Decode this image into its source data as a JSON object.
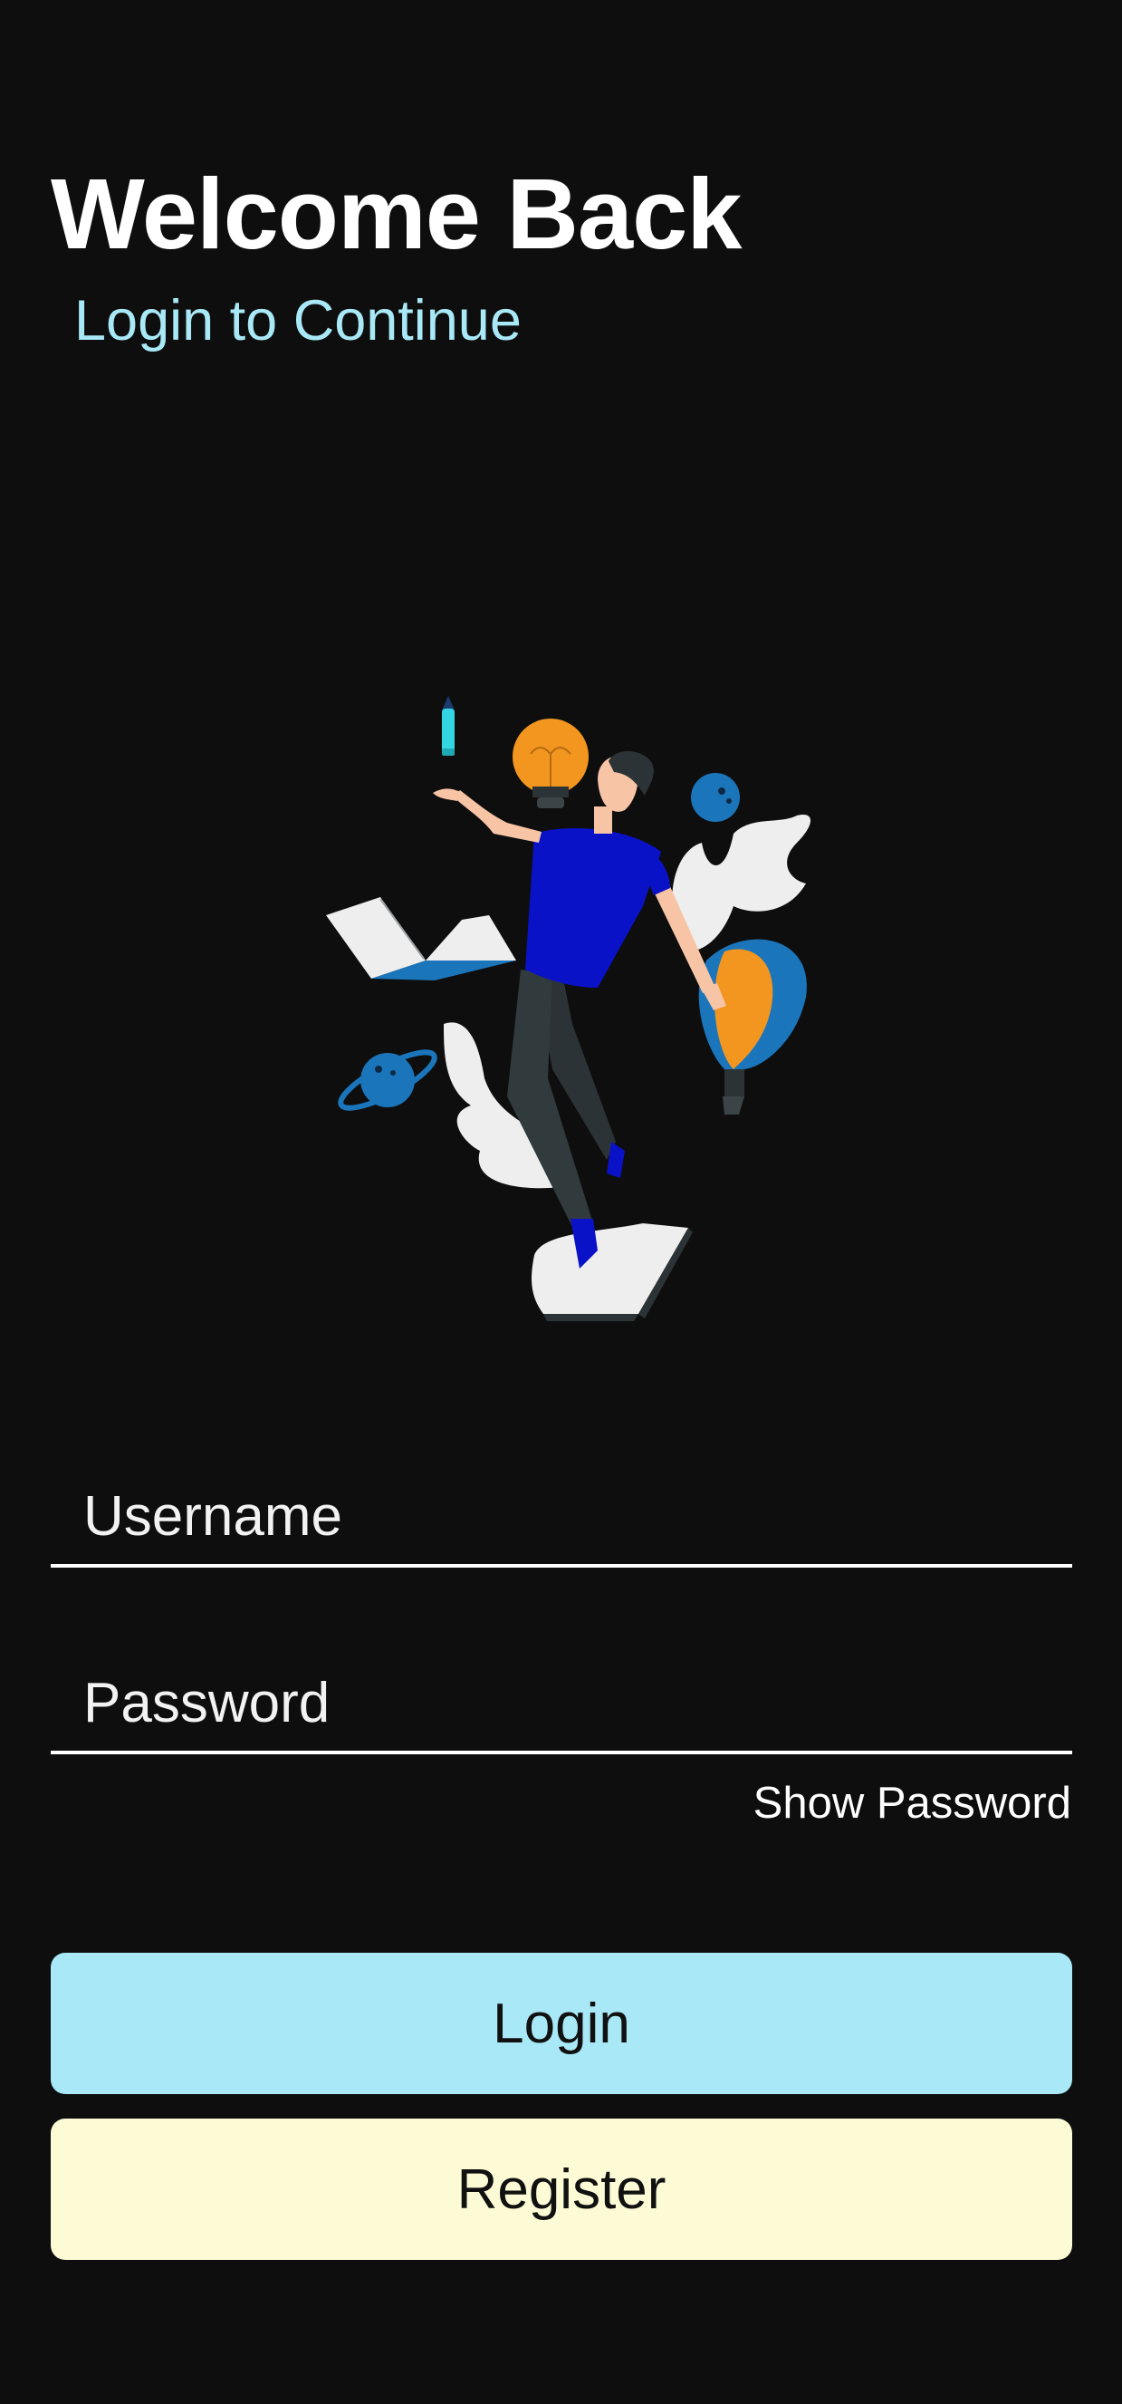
{
  "header": {
    "title": "Welcome Back",
    "subtitle": "Login to Continue"
  },
  "illustration": {
    "icon": "person-floating-ideas-illustration",
    "colors": {
      "shirt": "#0a12c8",
      "pants": "#2b3336",
      "skin": "#f7c4a5",
      "bulb": "#f2961f",
      "blue": "#1b75bb",
      "white": "#eeeeee",
      "pencil": "#33d6e2"
    }
  },
  "form": {
    "username_placeholder": "Username",
    "password_placeholder": "Password",
    "show_password_label": "Show Password"
  },
  "buttons": {
    "login_label": "Login",
    "register_label": "Register"
  },
  "colors": {
    "background": "#0e0e0e",
    "accent_cyan": "#a9e9f7",
    "accent_cream": "#fdfbd5",
    "text": "#ffffff"
  }
}
